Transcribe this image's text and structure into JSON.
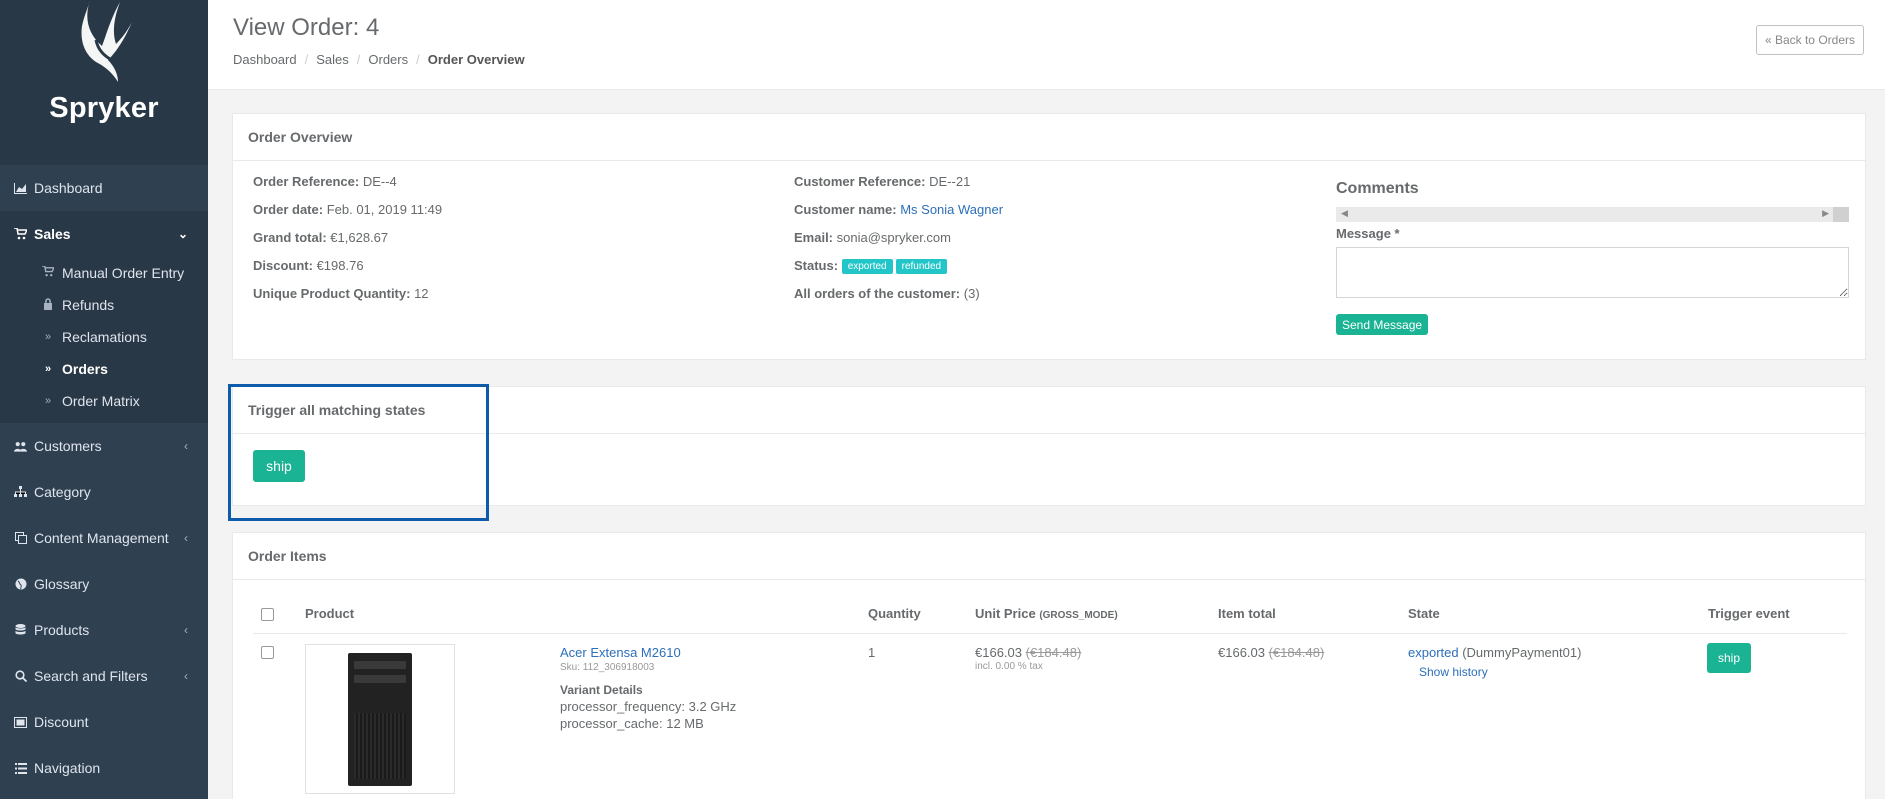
{
  "sidebar": {
    "brand": "Spryker",
    "items": [
      {
        "label": "Dashboard",
        "icon": "chart-area-icon"
      },
      {
        "label": "Sales",
        "icon": "cart-icon"
      },
      {
        "label": "Customers",
        "icon": "users-icon"
      },
      {
        "label": "Category",
        "icon": "sitemap-icon"
      },
      {
        "label": "Content Management",
        "icon": "copy-icon"
      },
      {
        "label": "Glossary",
        "icon": "globe-icon"
      },
      {
        "label": "Products",
        "icon": "database-icon"
      },
      {
        "label": "Search and Filters",
        "icon": "search-icon"
      },
      {
        "label": "Discount",
        "icon": "discount-icon"
      },
      {
        "label": "Navigation",
        "icon": "list-icon"
      }
    ],
    "sales_sub": [
      {
        "label": "Manual Order Entry",
        "icon": "cart-icon"
      },
      {
        "label": "Refunds",
        "icon": "lock-icon"
      },
      {
        "label": "Reclamations",
        "icon": "double-chevron-icon"
      },
      {
        "label": "Orders",
        "icon": "double-chevron-icon"
      },
      {
        "label": "Order Matrix",
        "icon": "double-chevron-icon"
      }
    ]
  },
  "header": {
    "title": "View Order: 4",
    "breadcrumb": [
      "Dashboard",
      "Sales",
      "Orders",
      "Order Overview"
    ],
    "back_button": "« Back to Orders"
  },
  "overview": {
    "title": "Order Overview",
    "left": [
      {
        "label": "Order Reference:",
        "value": "DE--4"
      },
      {
        "label": "Order date:",
        "value": "Feb. 01, 2019 11:49"
      },
      {
        "label": "Grand total:",
        "value": "€1,628.67"
      },
      {
        "label": "Discount:",
        "value": "€198.76"
      },
      {
        "label": "Unique Product Quantity:",
        "value": "12"
      }
    ],
    "customer_reference_label": "Customer Reference:",
    "customer_reference": "DE--21",
    "customer_name_label": "Customer name:",
    "customer_name": "Ms Sonia Wagner",
    "email_label": "Email:",
    "email": "sonia@spryker.com",
    "status_label": "Status:",
    "statuses": [
      "exported",
      "refunded"
    ],
    "all_orders_label": "All orders of the customer:",
    "all_orders_value": "(3)",
    "comments_title": "Comments",
    "message_label": "Message *",
    "send_button": "Send Message"
  },
  "trigger": {
    "title": "Trigger all matching states",
    "button": "ship"
  },
  "items": {
    "title": "Order Items",
    "columns": {
      "product": "Product",
      "quantity": "Quantity",
      "unit_price": "Unit Price",
      "unit_price_mode": "(GROSS_MODE)",
      "item_total": "Item total",
      "state": "State",
      "trigger_event": "Trigger event"
    },
    "rows": [
      {
        "name": "Acer Extensa M2610",
        "sku": "Sku: 112_306918003",
        "variant_title": "Variant Details",
        "variant_1": "processor_frequency: 3.2 GHz",
        "variant_2": "processor_cache: 12 MB",
        "quantity": "1",
        "unit_price": "€166.03",
        "unit_price_old": "(€184.48)",
        "tax_note": "incl. 0.00 % tax",
        "item_total": "€166.03",
        "item_total_old": "(€184.48)",
        "state": "exported",
        "state_process": "(DummyPayment01)",
        "show_history": "Show history",
        "trigger": "ship"
      }
    ]
  }
}
